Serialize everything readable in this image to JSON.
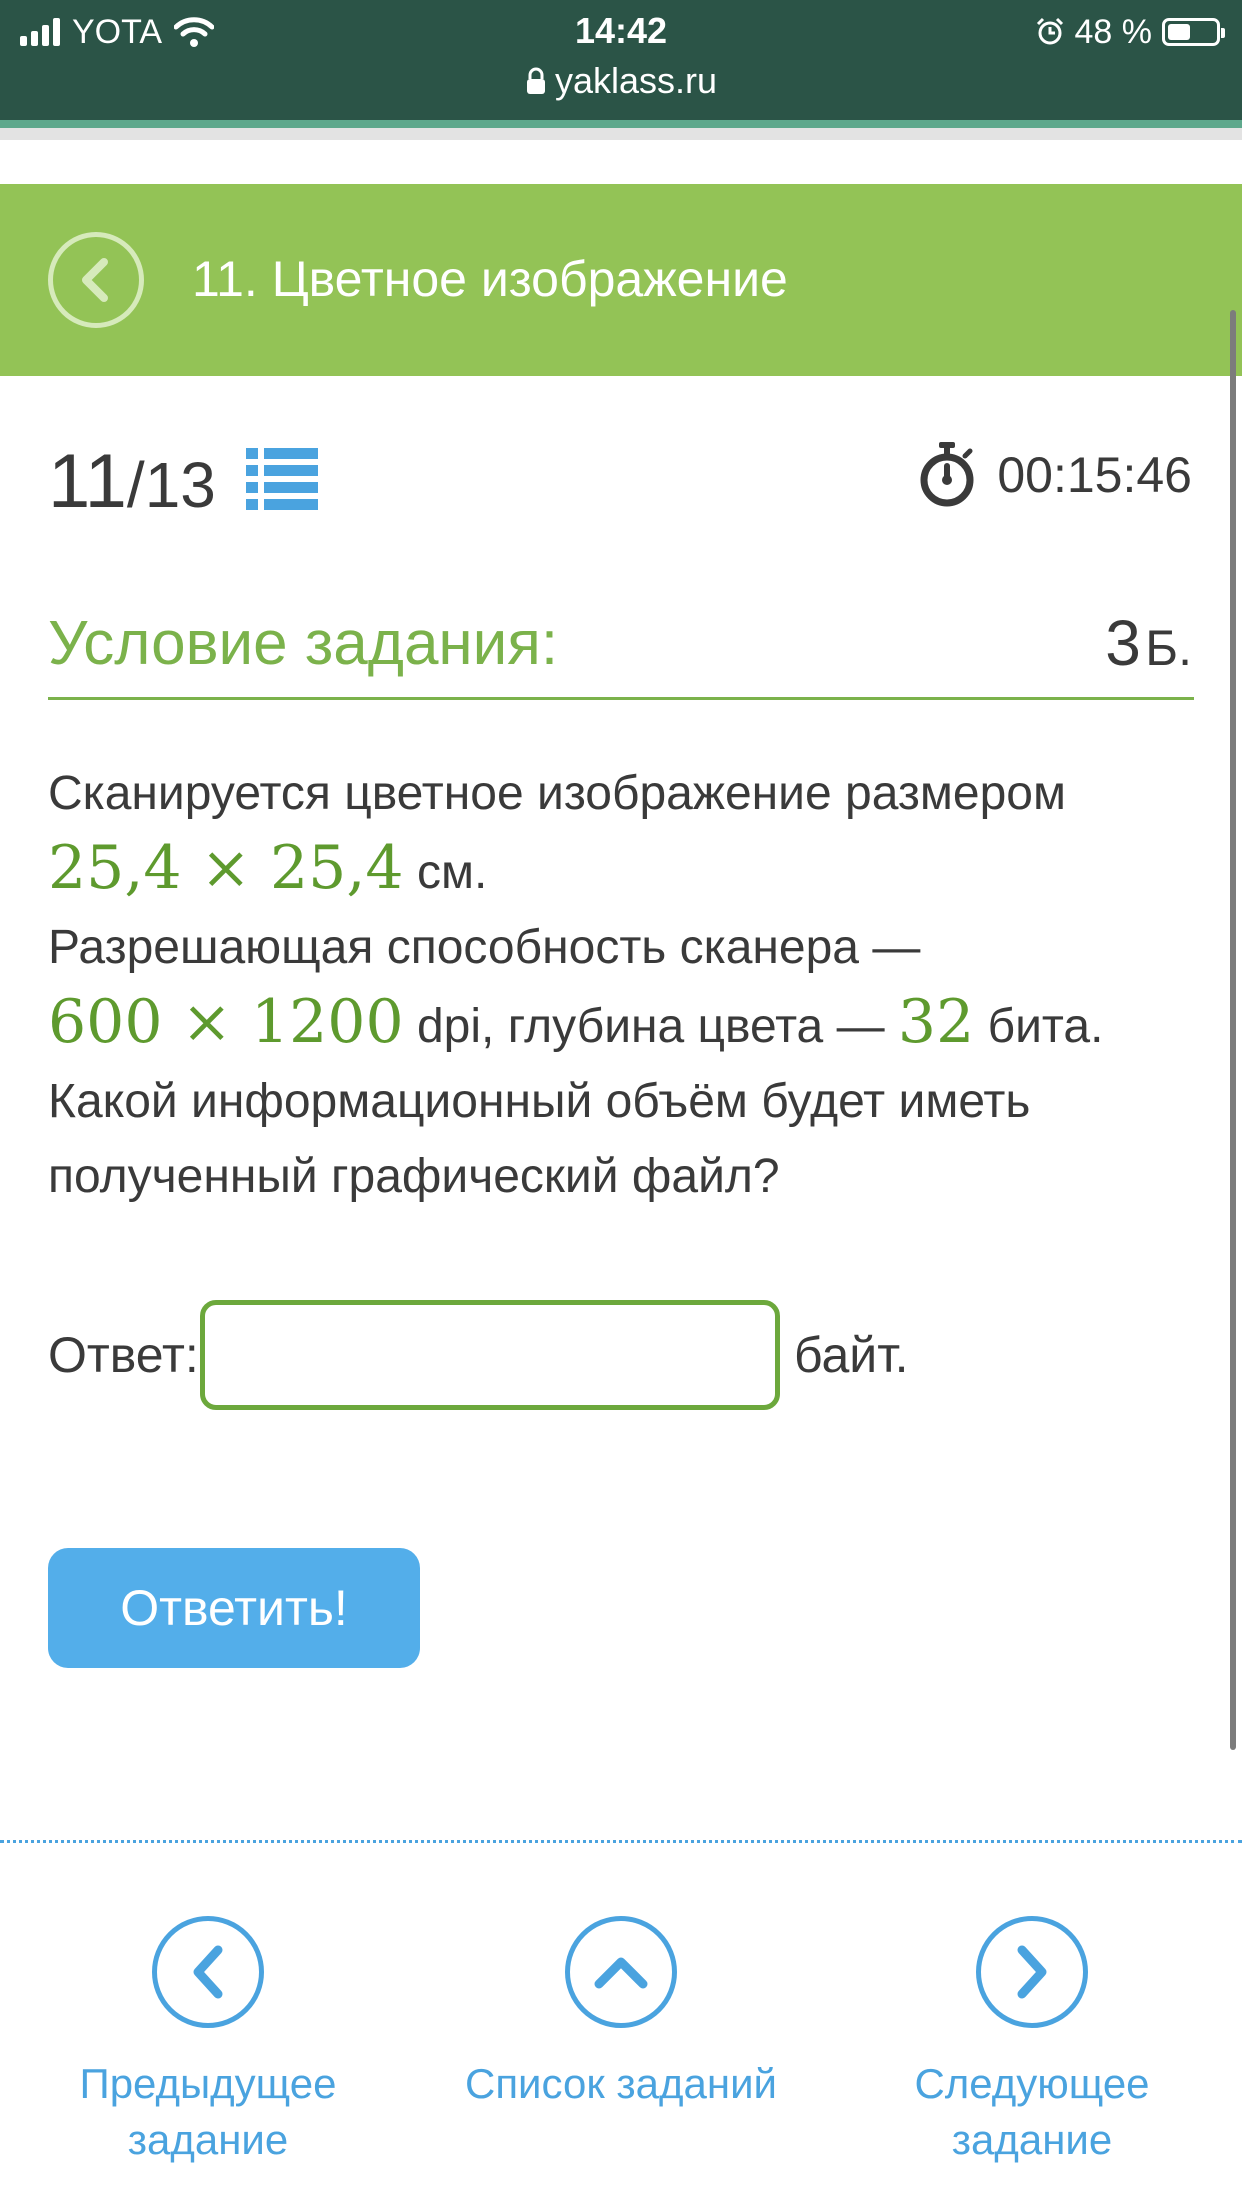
{
  "status_bar": {
    "carrier": "YOTA",
    "time": "14:42",
    "url": "yaklass.ru",
    "battery": "48 %"
  },
  "header": {
    "title": "11. Цветное изображение"
  },
  "progress": {
    "current": "11",
    "total": "/13",
    "timer": "00:15:46"
  },
  "condition": {
    "title": "Условие задания:",
    "points": "3",
    "points_unit": "Б."
  },
  "task": {
    "text1": "Сканируется цветное изображение размером",
    "math1": "25,4 × 25,4",
    "text2": " см.",
    "text3": "Разрешающая способность сканера —",
    "math2": "600 × 1200",
    "text4": " dpi, глубина цвета — ",
    "math3": "32",
    "text5": " бита.",
    "text6": "Какой информационный объём будет иметь",
    "text7": "полученный графический файл?"
  },
  "answer": {
    "label": "Ответ:",
    "value": "",
    "unit": "байт."
  },
  "submit_label": "Ответить!",
  "bottom_nav": {
    "prev_line1": "Предыдущее",
    "prev_line2": "задание",
    "list_label": "Список заданий",
    "next_line1": "Следующее",
    "next_line2": "задание"
  },
  "colors": {
    "status_bar": "#2b5447",
    "header_green": "#93c356",
    "accent_green": "#7bb24b",
    "math_green": "#5e9a2e",
    "accent_blue": "#53aeea",
    "link_blue": "#4aa3df"
  }
}
